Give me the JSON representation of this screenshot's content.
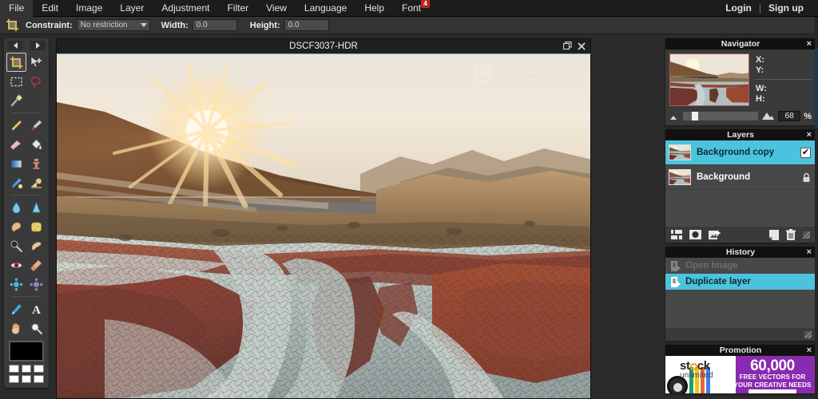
{
  "menu": {
    "items": [
      {
        "label": "File"
      },
      {
        "label": "Edit"
      },
      {
        "label": "Image"
      },
      {
        "label": "Layer"
      },
      {
        "label": "Adjustment"
      },
      {
        "label": "Filter"
      },
      {
        "label": "View"
      },
      {
        "label": "Language"
      },
      {
        "label": "Help"
      },
      {
        "label": "Font",
        "badge": "4"
      }
    ],
    "login": "Login",
    "separator": "|",
    "signup": "Sign up"
  },
  "options": {
    "tool_icon": "crop-icon",
    "constraint_label": "Constraint:",
    "constraint_value": "No restriction",
    "width_label": "Width:",
    "width_value": "0.0",
    "height_label": "Height:",
    "height_value": "0.0"
  },
  "toolbar": {
    "prev_arrow": "arrow-left-icon",
    "next_arrow": "arrow-right-icon",
    "tools": [
      {
        "name": "crop-tool",
        "active": true
      },
      {
        "name": "move-tool",
        "active": false
      },
      {
        "name": "marquee-select-tool",
        "active": false
      },
      {
        "name": "lasso-select-tool",
        "active": false
      },
      {
        "name": "magic-wand-tool",
        "active": false
      },
      {
        "name": "pencil-tool",
        "active": false
      },
      {
        "name": "brush-tool",
        "active": false
      },
      {
        "name": "eraser-tool",
        "active": false
      },
      {
        "name": "paint-bucket-tool",
        "active": false
      },
      {
        "name": "gradient-tool",
        "active": false
      },
      {
        "name": "clone-stamp-tool",
        "active": false
      },
      {
        "name": "color-replace-tool",
        "active": false
      },
      {
        "name": "drawing-tool",
        "active": false
      },
      {
        "name": "blur-tool",
        "active": false
      },
      {
        "name": "sharpen-tool",
        "active": false
      },
      {
        "name": "smudge-tool",
        "active": false
      },
      {
        "name": "sponge-tool",
        "active": false
      },
      {
        "name": "dodge-tool",
        "active": false
      },
      {
        "name": "burn-tool",
        "active": false
      },
      {
        "name": "red-eye-tool",
        "active": false
      },
      {
        "name": "spot-heal-tool",
        "active": false
      },
      {
        "name": "bloat-tool",
        "active": false
      },
      {
        "name": "pinch-tool",
        "active": false
      },
      {
        "name": "eyedropper-tool",
        "active": false
      },
      {
        "name": "type-tool",
        "active": false
      },
      {
        "name": "hand-tool",
        "active": false
      },
      {
        "name": "zoom-tool",
        "active": false
      }
    ],
    "foreground_color": "#000000",
    "palette_colors": [
      "#ffffff",
      "#ffffff",
      "#ffffff",
      "#ffffff",
      "#ffffff",
      "#ffffff"
    ]
  },
  "document": {
    "title": "DSCF3037-HDR",
    "restore_icon": "restore-window-icon",
    "close_icon": "close-icon",
    "watermark": "Elena Liseykina",
    "watermark_logo": "camera-badge-icon"
  },
  "navigator": {
    "title": "Navigator",
    "close": "×",
    "x_label": "X:",
    "y_label": "Y:",
    "w_label": "W:",
    "h_label": "H:",
    "x_value": "",
    "y_value": "",
    "w_value": "",
    "h_value": "",
    "zoom_out_icon": "zoom-out-mountain-icon",
    "zoom_in_icon": "zoom-in-mountain-icon",
    "zoom_value": "68",
    "zoom_unit": "%"
  },
  "layers": {
    "title": "Layers",
    "close": "×",
    "items": [
      {
        "name": "Background copy",
        "selected": true,
        "visible_check": "✔",
        "locked": false
      },
      {
        "name": "Background",
        "selected": false,
        "visible_check": "",
        "locked": true,
        "lock_icon": "lock-icon"
      }
    ],
    "tools": [
      {
        "name": "layer-settings-icon"
      },
      {
        "name": "layer-mask-icon"
      },
      {
        "name": "add-layer-icon"
      },
      {
        "name": "duplicate-layer-icon"
      },
      {
        "name": "delete-layer-icon"
      },
      {
        "name": "resize-grip-icon"
      }
    ]
  },
  "history": {
    "title": "History",
    "close": "×",
    "items": [
      {
        "label": "Open Image",
        "state": "dim"
      },
      {
        "label": "Duplicate layer",
        "state": "selected"
      }
    ],
    "grip": "resize-grip-icon"
  },
  "promotion": {
    "title": "Promotion",
    "close": "×",
    "brand_line1": "st",
    "brand_line1b": "ck",
    "brand_line2": "unlimited",
    "headline": "60,000",
    "sub1": "FREE VECTORS FOR",
    "sub2": "YOUR CREATIVE NEEDS"
  },
  "colors": {
    "accent": "#4cc3de",
    "panel_bg": "#3a3a3a",
    "panel_header": "#111111",
    "menu_bg": "#1c1c1c",
    "options_bg": "#333333",
    "badge_red": "#c0241d",
    "nav_frame": "#b25858"
  }
}
